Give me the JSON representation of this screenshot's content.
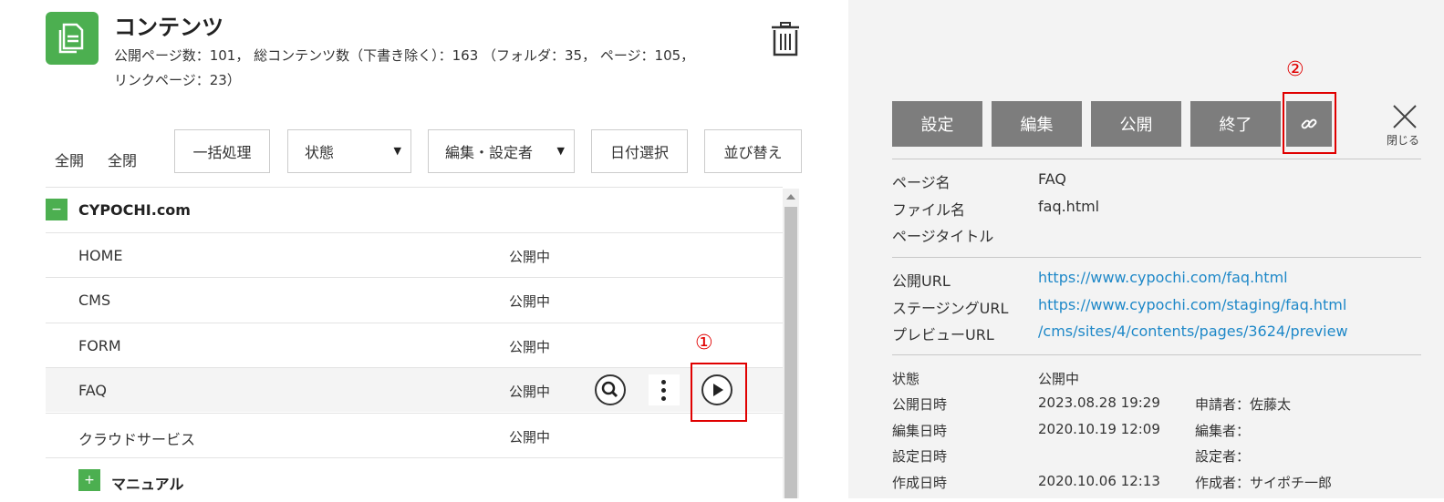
{
  "header": {
    "title": "コンテンツ",
    "summary_line1": "公開ページ数：101， 総コンテンツ数（下書き除く）：163 （フォルダ：35， ページ：105，",
    "summary_line2": "リンクページ：23）"
  },
  "controls": {
    "expand_all": "全開",
    "collapse_all": "全閉",
    "bulk": "一括処理",
    "status": "状態",
    "editor": "編集・設定者",
    "date": "日付選択",
    "sort": "並び替え"
  },
  "tree": {
    "root": "CYPOCHI.com",
    "items": [
      {
        "name": "HOME",
        "status": "公開中"
      },
      {
        "name": "CMS",
        "status": "公開中"
      },
      {
        "name": "FORM",
        "status": "公開中"
      },
      {
        "name": "FAQ",
        "status": "公開中"
      },
      {
        "name": "クラウドサービス",
        "status": "公開中"
      }
    ],
    "folder": "マニュアル"
  },
  "annotations": {
    "one": "①",
    "two": "②"
  },
  "detail": {
    "buttons": [
      "設定",
      "編集",
      "公開",
      "終了"
    ],
    "close": "閉じる",
    "info": [
      {
        "label": "ページ名",
        "value": "FAQ"
      },
      {
        "label": "ファイル名",
        "value": "faq.html"
      },
      {
        "label": "ページタイトル",
        "value": ""
      }
    ],
    "urls": [
      {
        "label": "公開URL",
        "value": "https://www.cypochi.com/faq.html"
      },
      {
        "label": "ステージングURL",
        "value": "https://www.cypochi.com/staging/faq.html"
      },
      {
        "label": "プレビューURL",
        "value": "/cms/sites/4/contents/pages/3624/preview"
      }
    ],
    "meta": [
      {
        "label": "状態",
        "value": "公開中",
        "who": ""
      },
      {
        "label": "公開日時",
        "value": "2023.08.28 19:29",
        "who": "申請者：佐藤太"
      },
      {
        "label": "編集日時",
        "value": "2020.10.19 12:09",
        "who": "編集者："
      },
      {
        "label": "設定日時",
        "value": "",
        "who": "設定者："
      },
      {
        "label": "作成日時",
        "value": "2020.10.06 12:13",
        "who": "作成者：サイポチ一郎"
      }
    ]
  },
  "colors": {
    "accent_green": "#4caf50",
    "action_gray": "#7d7d7d",
    "link_blue": "#1e88c8",
    "highlight_red": "#e00000"
  }
}
